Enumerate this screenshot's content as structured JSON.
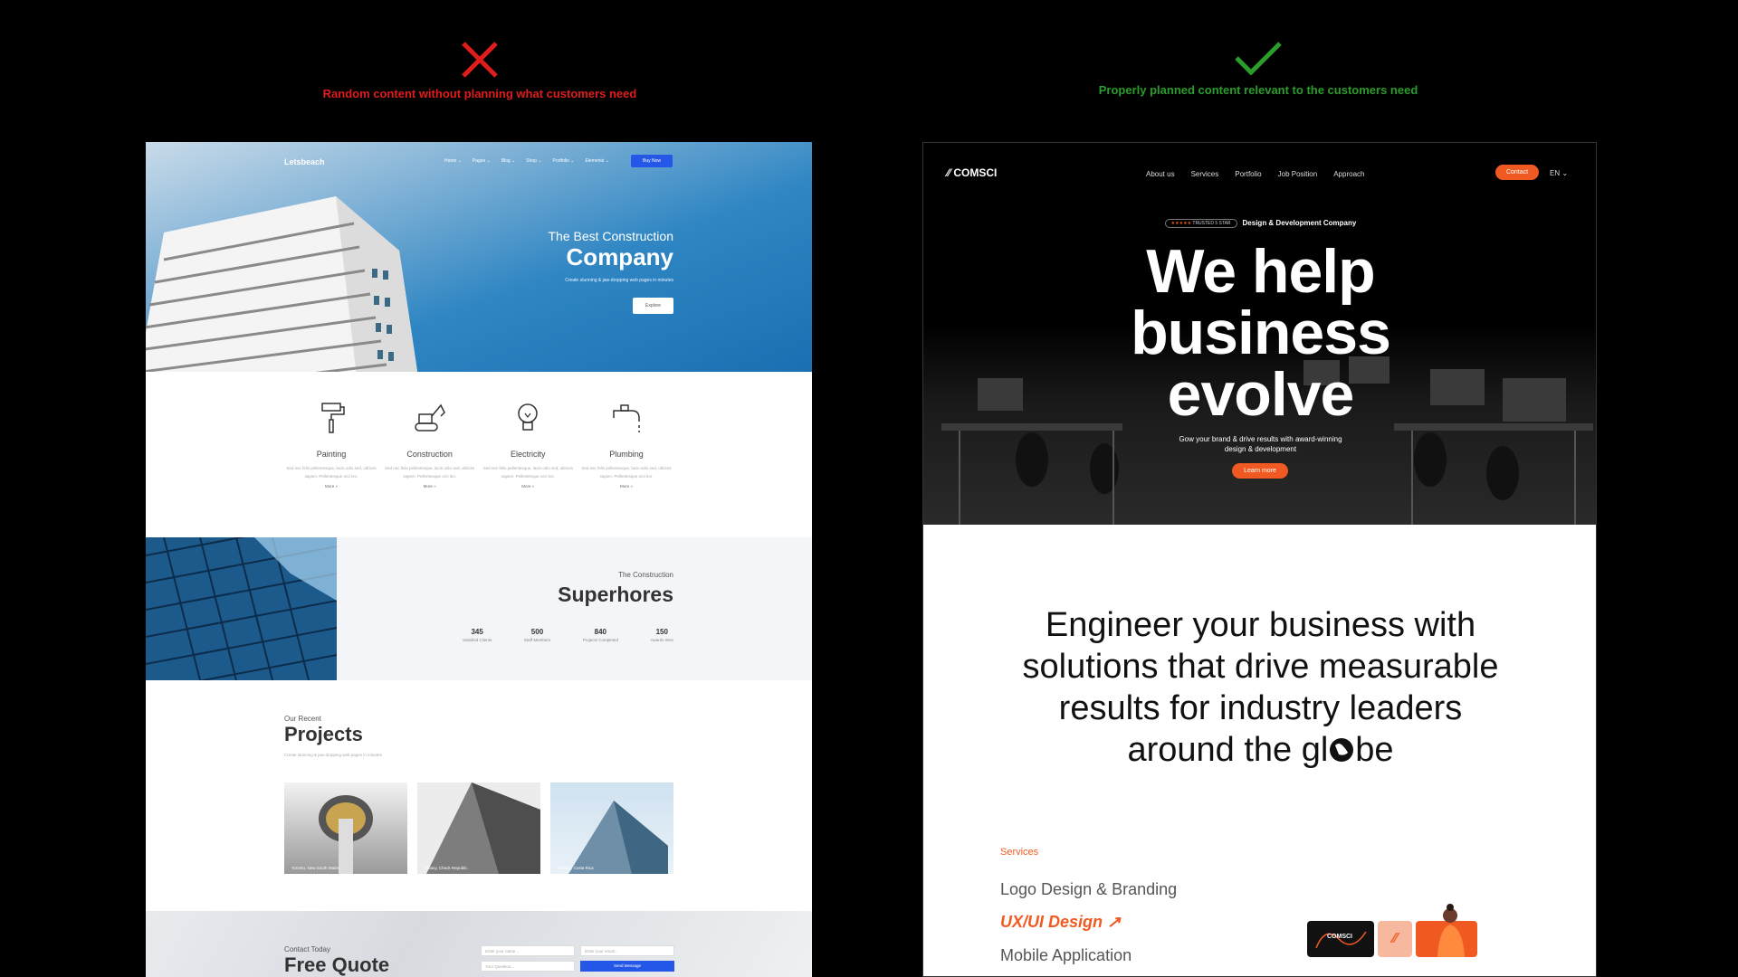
{
  "top_labels": {
    "bad": {
      "caption": "Random content without planning what customers need",
      "icon": "cross-icon",
      "color": "#e01c1c"
    },
    "good": {
      "caption": "Properly planned content relevant to the customers need",
      "icon": "check-icon",
      "color": "#2a9d2a"
    }
  },
  "left_site": {
    "logo": "Letsbeach",
    "menu": [
      "Home ⌄",
      "Pages ⌄",
      "Blog ⌄",
      "Shop ⌄",
      "Portfolio ⌄",
      "Elements ⌄"
    ],
    "buy_button": "Buy Now",
    "hero": {
      "subtitle": "The Best Construction",
      "title": "Company",
      "description": "Create stunning & jaw-dropping web pages in minutes",
      "button": "Explore"
    },
    "services": [
      {
        "name": "Painting",
        "icon": "paint-roller-icon",
        "text": "Sed nec felis pellentesque, lacin odio sed, ultrices sapien. Pellentesque orci leo.",
        "more": "More »"
      },
      {
        "name": "Construction",
        "icon": "excavator-icon",
        "text": "Sed nec felis pellentesque, lacin odio sed, ultrices sapien. Pellentesque orci leo.",
        "more": "More »"
      },
      {
        "name": "Electricity",
        "icon": "lightbulb-icon",
        "text": "Sed nec felis pellentesque, lacin odio sed, ultrices sapien. Pellentesque orci leo.",
        "more": "More »"
      },
      {
        "name": "Plumbing",
        "icon": "faucet-icon",
        "text": "Sed nec felis pellentesque, lacin odio sed, ultrices sapien. Pellentesque orci leo.",
        "more": "More »"
      }
    ],
    "stats": {
      "subtitle": "The Construction",
      "title": "Superhores",
      "items": [
        {
          "value": "345",
          "label": "Satisfied Clients"
        },
        {
          "value": "500",
          "label": "Staff Members"
        },
        {
          "value": "840",
          "label": "Projects Completed"
        },
        {
          "value": "150",
          "label": "Awards Won"
        }
      ]
    },
    "projects": {
      "subtitle": "Our Recent",
      "title": "Projects",
      "description": "Create stunning & jaw-dropping web pages in minutes",
      "cards": [
        {
          "caption": "Toronto, New South Wales"
        },
        {
          "caption": "Albany, Check Republic"
        },
        {
          "caption": "Turning, Costa Rica"
        }
      ]
    },
    "contact": {
      "subtitle": "Contact Today",
      "title": "Free Quote",
      "name_placeholder": "Enter your name...",
      "email_placeholder": "Enter your email...",
      "question_placeholder": "Your Question...",
      "send": "Send Message"
    }
  },
  "right_site": {
    "logo": "COMSCI",
    "menu": [
      "About us",
      "Services",
      "Portfolio",
      "Job Position",
      "Approach"
    ],
    "contact_button": "Contact",
    "language": "EN ⌄",
    "badge": {
      "stars": "★★★★★",
      "text": "TRUSTED 5 STAR"
    },
    "badge_label": "Design & Development Company",
    "headline": [
      "We help",
      "business",
      "evolve"
    ],
    "description": [
      "Gow your brand & drive results with award-winning",
      "design & development"
    ],
    "learn_more": "Learn more",
    "engineer": [
      "Engineer your business with",
      "solutions that drive measurable",
      "results for industry leaders",
      "around the gl",
      "be"
    ],
    "services_label": "Services",
    "services": [
      {
        "label": "Logo Design & Branding",
        "active": false
      },
      {
        "label": "UX/UI Design ↗",
        "active": true
      },
      {
        "label": "Mobile Application",
        "active": false
      }
    ],
    "tile_logo": "COMSCI",
    "accent": "#f05a22"
  }
}
